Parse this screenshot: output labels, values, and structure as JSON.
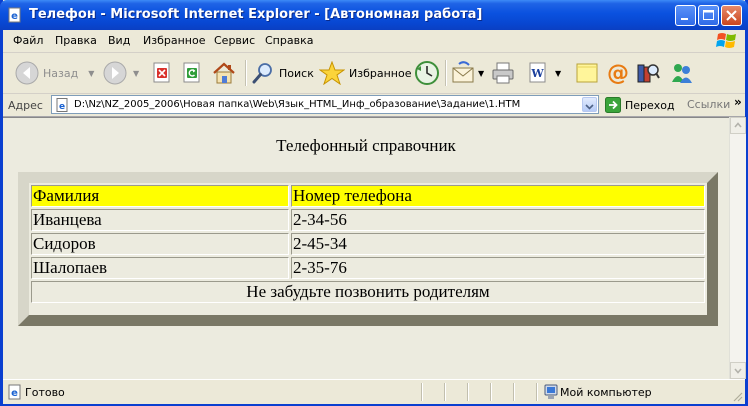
{
  "window": {
    "title": "Телефон - Microsoft Internet Explorer - [Автономная работа]"
  },
  "menu": [
    "Файл",
    "Правка",
    "Вид",
    "Избранное",
    "Сервис",
    "Справка"
  ],
  "toolbar": {
    "back_label": "Назад",
    "search_label": "Поиск",
    "favorites_label": "Избранное"
  },
  "address": {
    "label": "Адрес",
    "url": "D:\\Nz\\NZ_2005_2006\\Новая папка\\Web\\Язык_HTML_Инф_образование\\Задание\\1.HTM",
    "go_label": "Переход",
    "links_label": "Ссылки"
  },
  "page": {
    "heading": "Телефонный справочник",
    "table": {
      "headers": [
        "Фамилия",
        "Номер телефона"
      ],
      "rows": [
        [
          "Иванцева",
          "2-34-56"
        ],
        [
          "Сидоров",
          "2-45-34"
        ],
        [
          "Шалопаев",
          "2-35-76"
        ]
      ],
      "footer": "Не забудьте позвонить родителям",
      "header_color": "#ffff00"
    }
  },
  "status": {
    "text": "Готово",
    "zone": "Мой компьютер"
  }
}
